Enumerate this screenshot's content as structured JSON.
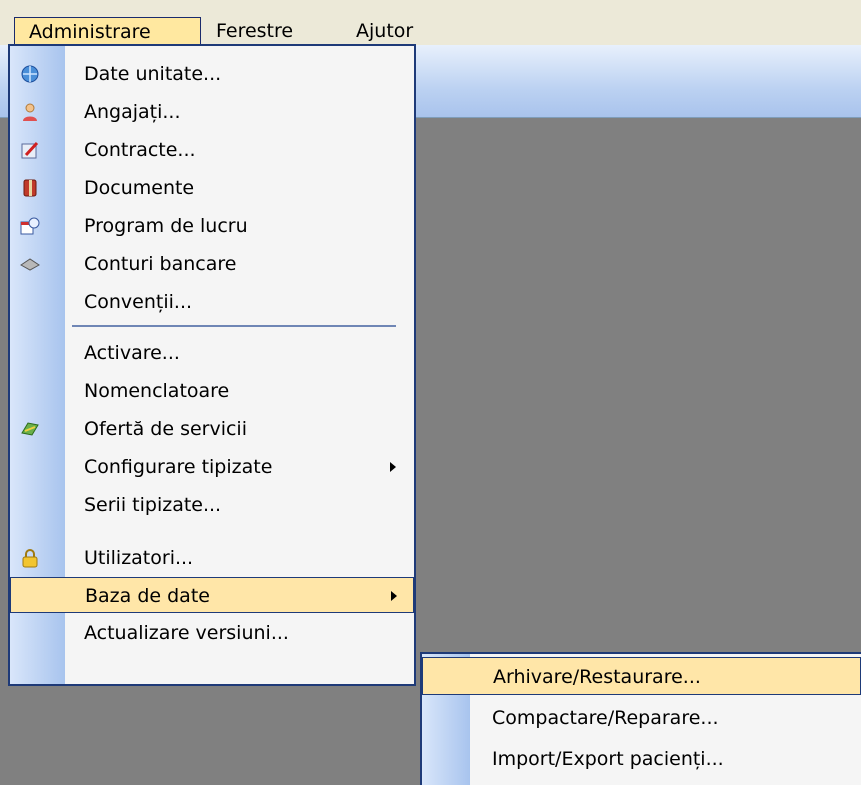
{
  "menubar": {
    "items": [
      {
        "label": "Administrare"
      },
      {
        "label": "Ferestre"
      },
      {
        "label": "Ajutor"
      }
    ]
  },
  "menu": {
    "items": [
      {
        "label": "Date unitate...",
        "icon": "database-globe-icon"
      },
      {
        "label": "Angajați...",
        "icon": "person-icon"
      },
      {
        "label": "Contracte...",
        "icon": "contract-pencil-icon"
      },
      {
        "label": "Documente",
        "icon": "documents-icon"
      },
      {
        "label": "Program de lucru",
        "icon": "calendar-clock-icon"
      },
      {
        "label": "Conturi bancare",
        "icon": "bank-card-icon"
      },
      {
        "label": "Convenții..."
      },
      {
        "label": "Activare..."
      },
      {
        "label": "Nomenclatoare"
      },
      {
        "label": "Ofertă de servicii",
        "icon": "services-offer-icon"
      },
      {
        "label": "Configurare tipizate"
      },
      {
        "label": "Serii tipizate..."
      },
      {
        "label": "Utilizatori...",
        "icon": "lock-icon"
      },
      {
        "label": "Baza de date"
      },
      {
        "label": "Actualizare versiuni..."
      }
    ]
  },
  "submenu": {
    "items": [
      {
        "label": "Arhivare/Restaurare..."
      },
      {
        "label": "Compactare/Reparare..."
      },
      {
        "label": "Import/Export pacienți..."
      }
    ]
  },
  "colors": {
    "menubar_bg": "#ece9d8",
    "highlight": "#ffe6a8",
    "border": "#1e3a78",
    "workspace": "#808080"
  }
}
